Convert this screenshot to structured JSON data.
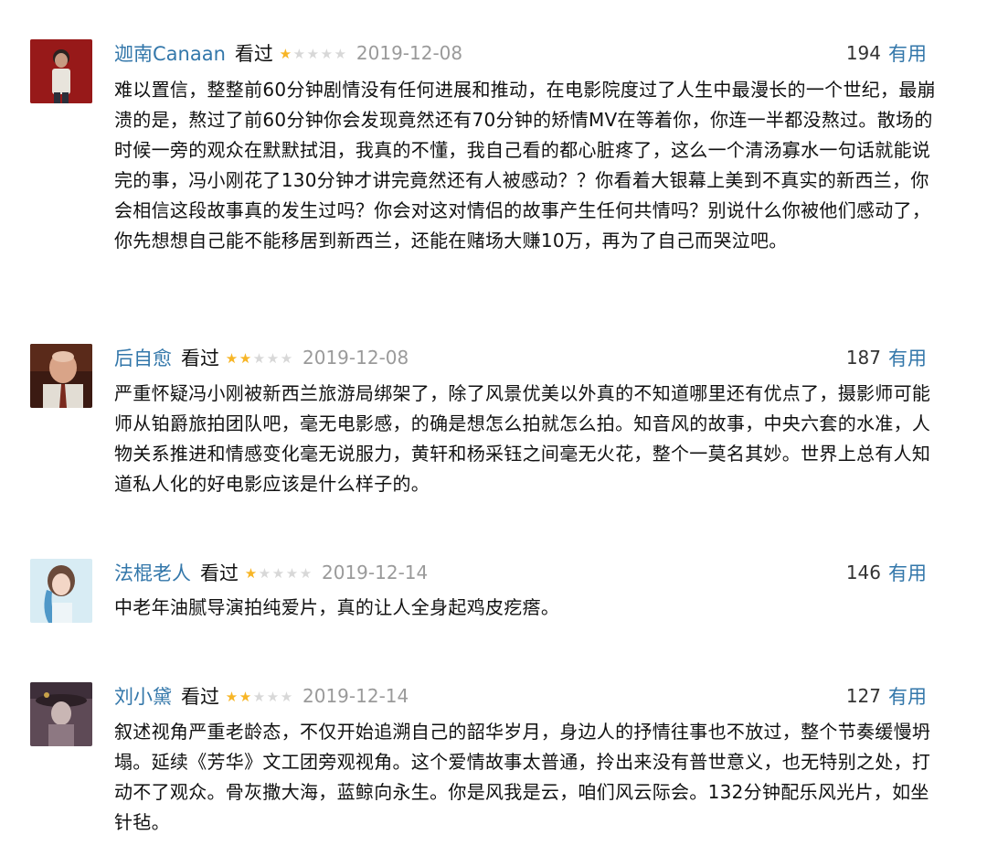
{
  "reviews": [
    {
      "user": "迦南Canaan",
      "status": "看过",
      "rating": 1,
      "date": "2019-12-08",
      "votes": "194",
      "useful_label": "有用",
      "content": "难以置信，整整前60分钟剧情没有任何进展和推动，在电影院度过了人生中最漫长的一个世纪，最崩溃的是，熬过了前60分钟你会发现竟然还有70分钟的矫情MV在等着你，你连一半都没熬过。散场的时候一旁的观众在默默拭泪，我真的不懂，我自己看的都心脏疼了，这么一个清汤寡水一句话就能说完的事，冯小刚花了130分钟才讲完竟然还有人被感动？？你看着大银幕上美到不真实的新西兰，你会相信这段故事真的发生过吗？你会对这对情侣的故事产生任何共情吗？别说什么你被他们感动了，你先想想自己能不能移居到新西兰，还能在赌场大赚10万，再为了自己而哭泣吧。"
    },
    {
      "user": "后自愈",
      "status": "看过",
      "rating": 2,
      "date": "2019-12-08",
      "votes": "187",
      "useful_label": "有用",
      "content": "严重怀疑冯小刚被新西兰旅游局绑架了，除了风景优美以外真的不知道哪里还有优点了，摄影师可能师从铂爵旅拍团队吧，毫无电影感，的确是想怎么拍就怎么拍。知音风的故事，中央六套的水准，人物关系推进和情感变化毫无说服力，黄轩和杨采钰之间毫无火花，整个一莫名其妙。世界上总有人知道私人化的好电影应该是什么样子的。"
    },
    {
      "user": "法棍老人",
      "status": "看过",
      "rating": 1,
      "date": "2019-12-14",
      "votes": "146",
      "useful_label": "有用",
      "content": "中老年油腻导演拍纯爱片，真的让人全身起鸡皮疙瘩。"
    },
    {
      "user": "刘小黛",
      "status": "看过",
      "rating": 2,
      "date": "2019-12-14",
      "votes": "127",
      "useful_label": "有用",
      "content": "叙述视角严重老龄态，不仅开始追溯自己的韶华岁月，身边人的抒情往事也不放过，整个节奏缓慢坍塌。延续《芳华》文工团旁观视角。这个爱情故事太普通，拎出来没有普世意义，也无特别之处，打动不了观众。骨灰撒大海，蓝鲸向永生。你是风我是云，咱们风云际会。132分钟配乐风光片，如坐针毡。"
    }
  ],
  "colors": {
    "link": "#3377aa",
    "star_on": "#f7b526",
    "star_off": "#d8d8d8",
    "date": "#9a9a9a"
  },
  "icons": {
    "star": "star-icon",
    "avatar": "avatar"
  }
}
